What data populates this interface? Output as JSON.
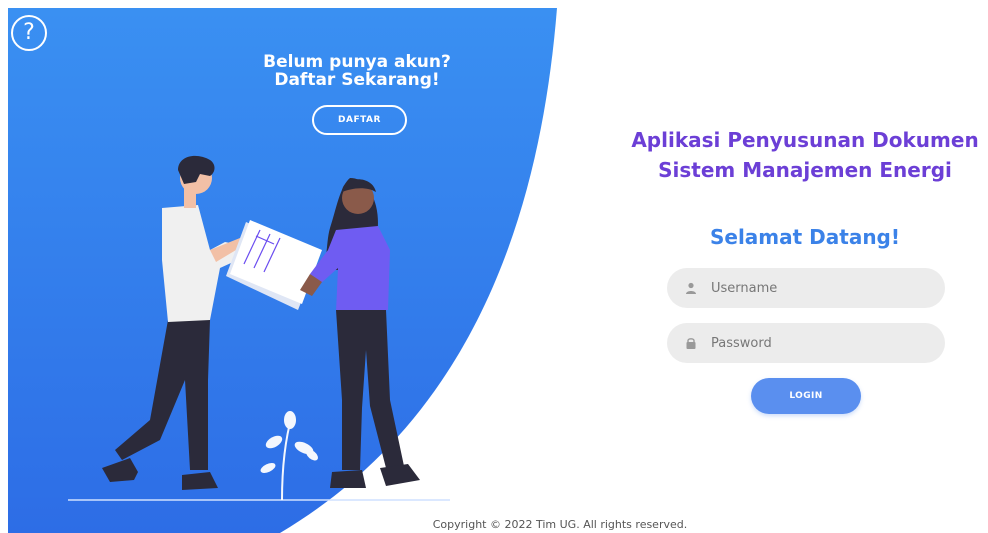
{
  "colors": {
    "panel_blue_top": "#3b8ff0",
    "panel_blue_bottom": "#2c6fe8",
    "title_purple": "#6c3fd6",
    "welcome_blue": "#3b82e8",
    "login_blue": "#5a8fef",
    "field_bg": "#ececec"
  },
  "help": {
    "label": "?",
    "icon": "help-circle-icon"
  },
  "promo": {
    "line1": "Belum punya akun?",
    "line2": "Daftar Sekarang!",
    "register_label": "DAFTAR"
  },
  "app": {
    "title_line1": "Aplikasi Penyusunan Dokumen",
    "title_line2": "Sistem Manajemen Energi",
    "welcome": "Selamat Datang!"
  },
  "form": {
    "username_placeholder": "Username",
    "username_value": "",
    "username_icon": "user-icon",
    "password_placeholder": "Password",
    "password_value": "",
    "password_icon": "lock-icon",
    "login_label": "LOGIN"
  },
  "footer": {
    "copyright": "Copyright © 2022 Tim UG. All rights reserved."
  }
}
